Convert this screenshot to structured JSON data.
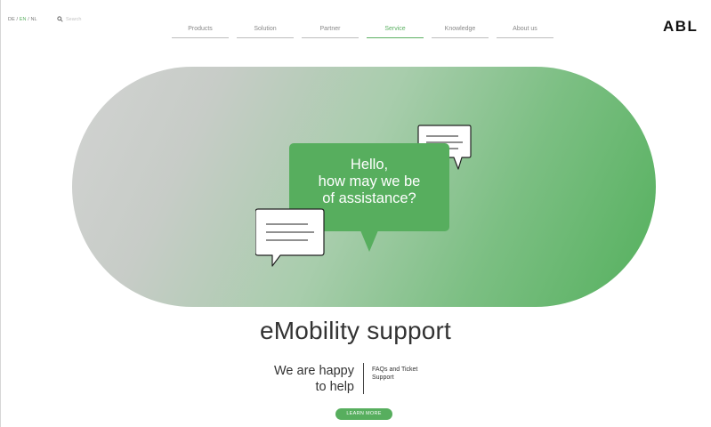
{
  "header": {
    "languages": [
      "DE",
      "EN",
      "NL"
    ],
    "language_separator": " / ",
    "active_language": "EN",
    "search_placeholder": "Search",
    "logo": "ABL"
  },
  "nav": {
    "items": [
      {
        "label": "Products",
        "active": false
      },
      {
        "label": "Solution",
        "active": false
      },
      {
        "label": "Partner",
        "active": false
      },
      {
        "label": "Service",
        "active": true
      },
      {
        "label": "Knowledge",
        "active": false
      },
      {
        "label": "About us",
        "active": false
      }
    ]
  },
  "hero": {
    "bubble_lines": [
      "Hello,",
      "how may we be",
      "of assistance?"
    ]
  },
  "content": {
    "headline": "eMobility support",
    "tagline_line1": "We are happy",
    "tagline_line2": "to help",
    "faq_line1": "FAQs and Ticket",
    "faq_line2": "Support",
    "cta": "LEARN MORE"
  },
  "colors": {
    "accent": "#57ae5e",
    "text": "#333333",
    "nav_text": "#888888"
  },
  "icons": [
    "search-icon",
    "chat-bubble-icon"
  ]
}
